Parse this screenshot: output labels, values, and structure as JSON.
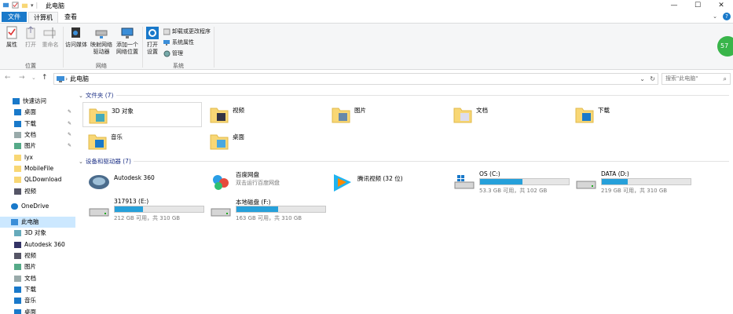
{
  "window": {
    "title": "此电脑",
    "controls": {
      "minimize": "—",
      "maximize": "☐",
      "close": "✕"
    }
  },
  "tabs": {
    "file": "文件",
    "computer": "计算机",
    "view": "查看",
    "expand": "⌄",
    "help": "?"
  },
  "ribbon": {
    "properties": "属性",
    "open": "打开",
    "rename": "重命名",
    "location_group": "位置",
    "access_media": "访问媒体",
    "map_drive_line1": "映射网络",
    "map_drive_line2": "驱动器",
    "add_location_line1": "添加一个",
    "add_location_line2": "网络位置",
    "network_group": "网络",
    "open_settings_line1": "打开",
    "open_settings_line2": "设置",
    "uninstall": "卸载或更改程序",
    "system_props": "系统属性",
    "manage": "管理",
    "system_group": "系统"
  },
  "badge": "57",
  "address": {
    "path": "此电脑",
    "search_placeholder": "搜索\"此电脑\""
  },
  "sidebar": {
    "items": [
      {
        "label": "快速访问",
        "icon": "star-icon"
      },
      {
        "label": "桌面",
        "icon": "desktop-icon"
      },
      {
        "label": "下载",
        "icon": "download-icon"
      },
      {
        "label": "文档",
        "icon": "document-icon"
      },
      {
        "label": "图片",
        "icon": "picture-icon"
      },
      {
        "label": "lyx",
        "icon": "folder-icon"
      },
      {
        "label": "MobileFile",
        "icon": "folder-icon"
      },
      {
        "label": "QLDownload",
        "icon": "folder-icon"
      },
      {
        "label": "视频",
        "icon": "video-icon"
      },
      {
        "label": "OneDrive",
        "icon": "cloud-icon"
      },
      {
        "label": "此电脑",
        "icon": "computer-icon"
      },
      {
        "label": "3D 对象",
        "icon": "3d-icon"
      },
      {
        "label": "Autodesk 360",
        "icon": "autodesk-icon"
      },
      {
        "label": "视频",
        "icon": "video-icon"
      },
      {
        "label": "图片",
        "icon": "picture-icon"
      },
      {
        "label": "文档",
        "icon": "document-icon"
      },
      {
        "label": "下载",
        "icon": "download-icon"
      },
      {
        "label": "音乐",
        "icon": "music-icon"
      },
      {
        "label": "桌面",
        "icon": "desktop-icon"
      }
    ]
  },
  "folders_group": {
    "label": "文件夹 (7)"
  },
  "folders": [
    {
      "name": "3D 对象",
      "icon": "3d-folder-icon"
    },
    {
      "name": "视频",
      "icon": "video-folder-icon"
    },
    {
      "name": "图片",
      "icon": "picture-folder-icon"
    },
    {
      "name": "文档",
      "icon": "document-folder-icon"
    },
    {
      "name": "下载",
      "icon": "download-folder-icon"
    },
    {
      "name": "音乐",
      "icon": "music-folder-icon"
    },
    {
      "name": "桌面",
      "icon": "desktop-folder-icon"
    }
  ],
  "devices_group": {
    "label": "设备和驱动器 (7)"
  },
  "devices": [
    {
      "name": "Autodesk 360",
      "icon": "autodesk-icon"
    },
    {
      "name": "百度网盘",
      "sub": "双击运行百度网盘",
      "icon": "baidu-icon"
    },
    {
      "name": "腾讯视频 (32 位)",
      "icon": "tencent-video-icon"
    },
    {
      "name": "OS (C:)",
      "sub": "53.3 GB 可用，共 102 GB",
      "used_fraction": 0.48,
      "icon": "windows-drive-icon"
    },
    {
      "name": "DATA (D:)",
      "sub": "219 GB 可用，共 310 GB",
      "used_fraction": 0.29,
      "icon": "drive-icon"
    },
    {
      "name": "317913 (E:)",
      "sub": "212 GB 可用，共 310 GB",
      "used_fraction": 0.32,
      "icon": "drive-icon"
    },
    {
      "name": "本地磁盘 (F:)",
      "sub": "163 GB 可用，共 310 GB",
      "used_fraction": 0.47,
      "icon": "drive-icon"
    }
  ],
  "colors": {
    "accent": "#1979ca",
    "bar_fill": "#26a0da",
    "selected": "#cce8ff",
    "folder": "#f8d775"
  }
}
